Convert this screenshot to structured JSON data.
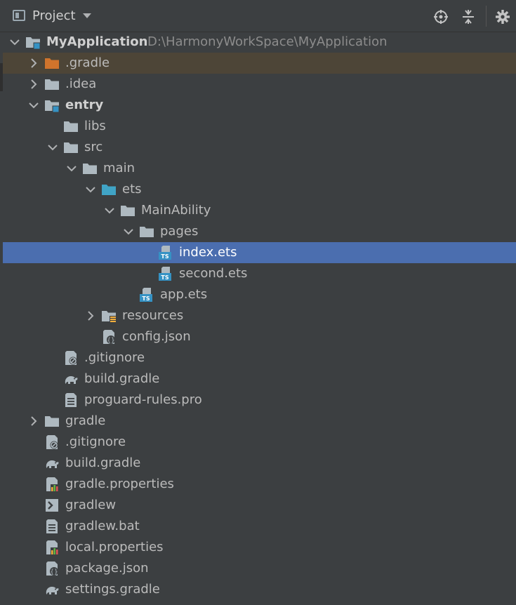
{
  "header": {
    "title": "Project",
    "icons": [
      "project-panel-icon",
      "dropdown-caret-icon",
      "locate-icon",
      "collapse-all-icon",
      "gear-icon"
    ]
  },
  "tree": [
    {
      "label": "MyApplication",
      "path": "D:\\HarmonyWorkSpace\\MyApplication",
      "depth": 0,
      "chevron": "down",
      "icon": "module-folder",
      "bold": true
    },
    {
      "label": ".gradle",
      "depth": 1,
      "chevron": "right",
      "icon": "orange-folder",
      "highlight": true
    },
    {
      "label": ".idea",
      "depth": 1,
      "chevron": "right",
      "icon": "folder"
    },
    {
      "label": "entry",
      "depth": 1,
      "chevron": "down",
      "icon": "module-folder",
      "bold": true
    },
    {
      "label": "libs",
      "depth": 2,
      "chevron": "none",
      "icon": "folder"
    },
    {
      "label": "src",
      "depth": 2,
      "chevron": "down",
      "icon": "folder"
    },
    {
      "label": "main",
      "depth": 3,
      "chevron": "down",
      "icon": "folder"
    },
    {
      "label": "ets",
      "depth": 4,
      "chevron": "down",
      "icon": "blue-folder"
    },
    {
      "label": "MainAbility",
      "depth": 5,
      "chevron": "down",
      "icon": "folder"
    },
    {
      "label": "pages",
      "depth": 6,
      "chevron": "down",
      "icon": "folder"
    },
    {
      "label": "index.ets",
      "depth": 7,
      "chevron": "none",
      "icon": "ts-file",
      "selected": true
    },
    {
      "label": "second.ets",
      "depth": 7,
      "chevron": "none",
      "icon": "ts-file"
    },
    {
      "label": "app.ets",
      "depth": 6,
      "chevron": "none",
      "icon": "ts-file"
    },
    {
      "label": "resources",
      "depth": 4,
      "chevron": "right",
      "icon": "resources-folder"
    },
    {
      "label": "config.json",
      "depth": 4,
      "chevron": "none",
      "icon": "json-file"
    },
    {
      "label": ".gitignore",
      "depth": 2,
      "chevron": "none",
      "icon": "ignore-file"
    },
    {
      "label": "build.gradle",
      "depth": 2,
      "chevron": "none",
      "icon": "gradle-elephant"
    },
    {
      "label": "proguard-rules.pro",
      "depth": 2,
      "chevron": "none",
      "icon": "text-file"
    },
    {
      "label": "gradle",
      "depth": 1,
      "chevron": "right",
      "icon": "folder"
    },
    {
      "label": ".gitignore",
      "depth": 1,
      "chevron": "none",
      "icon": "ignore-file"
    },
    {
      "label": "build.gradle",
      "depth": 1,
      "chevron": "none",
      "icon": "gradle-elephant"
    },
    {
      "label": "gradle.properties",
      "depth": 1,
      "chevron": "none",
      "icon": "properties-file"
    },
    {
      "label": "gradlew",
      "depth": 1,
      "chevron": "none",
      "icon": "shell-file"
    },
    {
      "label": "gradlew.bat",
      "depth": 1,
      "chevron": "none",
      "icon": "text-file"
    },
    {
      "label": "local.properties",
      "depth": 1,
      "chevron": "none",
      "icon": "properties-file"
    },
    {
      "label": "package.json",
      "depth": 1,
      "chevron": "none",
      "icon": "json-file"
    },
    {
      "label": "settings.gradle",
      "depth": 1,
      "chevron": "none",
      "icon": "gradle-elephant"
    }
  ]
}
